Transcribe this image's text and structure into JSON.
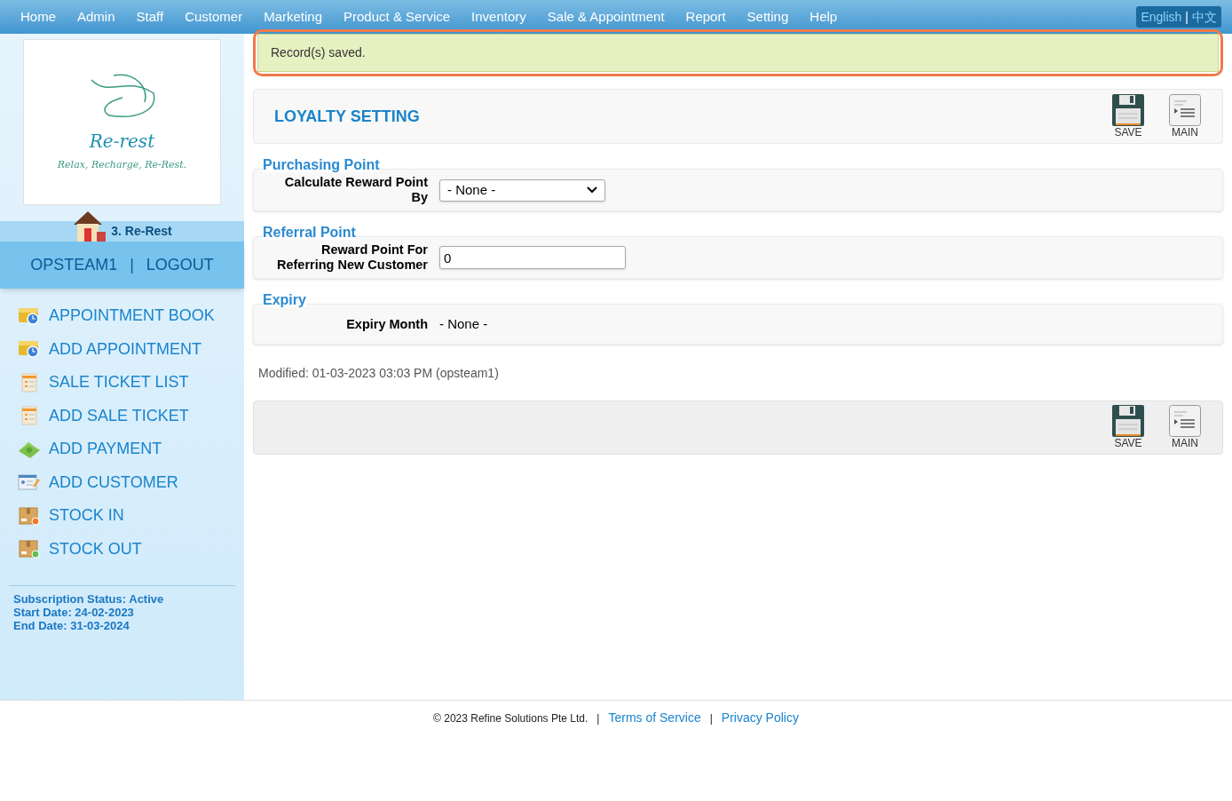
{
  "nav": {
    "items": [
      "Home",
      "Admin",
      "Staff",
      "Customer",
      "Marketing",
      "Product & Service",
      "Inventory",
      "Sale & Appointment",
      "Report",
      "Setting",
      "Help"
    ],
    "languages": [
      "English",
      "中文"
    ],
    "separator": "|"
  },
  "sidebar": {
    "logo": {
      "name": "Re-rest",
      "tagline": "Relax, Recharge, Re-Rest."
    },
    "outlet": "3. Re-Rest",
    "user": "OPSTEAM1",
    "separator": "|",
    "logout": "LOGOUT",
    "menu": [
      {
        "label": "APPOINTMENT BOOK",
        "kind": "calendar"
      },
      {
        "label": "ADD APPOINTMENT",
        "kind": "calendar"
      },
      {
        "label": "SALE TICKET LIST",
        "kind": "ticket"
      },
      {
        "label": "ADD SALE TICKET",
        "kind": "ticket"
      },
      {
        "label": "ADD PAYMENT",
        "kind": "money"
      },
      {
        "label": "ADD CUSTOMER",
        "kind": "customer"
      },
      {
        "label": "STOCK IN",
        "kind": "stockin"
      },
      {
        "label": "STOCK OUT",
        "kind": "stockout"
      }
    ],
    "subscription": [
      "Subscription Status: Active",
      "Start Date: 24-02-2023",
      "End Date: 31-03-2024"
    ]
  },
  "alert": "Record(s) saved.",
  "page_title": "LOYALTY SETTING",
  "toolbar": [
    {
      "label": "SAVE",
      "kind": "save"
    },
    {
      "label": "MAIN",
      "kind": "main"
    }
  ],
  "sections": [
    {
      "legend": "Purchasing Point",
      "label": "Calculate Reward Point By",
      "kind": "select",
      "value": "- None -"
    },
    {
      "legend": "Referral Point",
      "label": "Reward Point For Referring New Customer",
      "kind": "input",
      "value": "0"
    },
    {
      "legend": "Expiry",
      "label": "Expiry Month",
      "kind": "text",
      "value": "- None -"
    }
  ],
  "modified": "Modified: 01-03-2023 03:03 PM (opsteam1)",
  "bottom_toolbar": [
    {
      "label": "SAVE",
      "kind": "save"
    },
    {
      "label": "MAIN",
      "kind": "main"
    }
  ],
  "footer": {
    "copyright": "© 2023 Refine Solutions Pte Ltd.",
    "separator": "|",
    "links": [
      "Terms of Service",
      "Privacy Policy"
    ]
  }
}
